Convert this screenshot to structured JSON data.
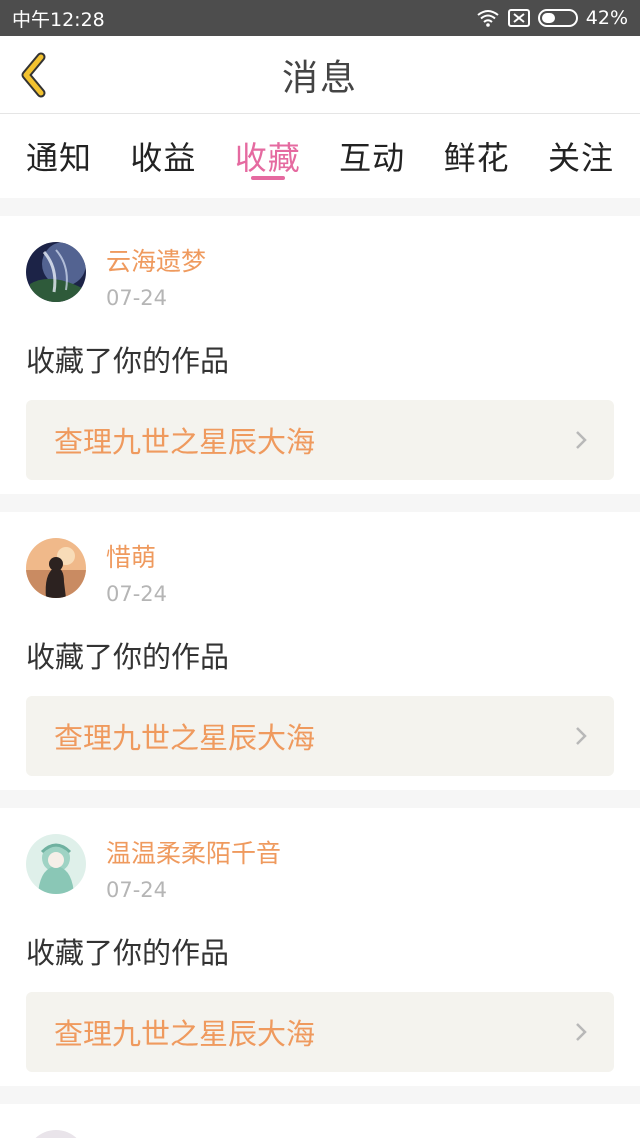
{
  "status_bar": {
    "time": "中午12:28",
    "battery_text": "42%",
    "battery_level": 0.42
  },
  "header": {
    "title": "消息"
  },
  "tabs": [
    {
      "label": "通知",
      "active": false
    },
    {
      "label": "收益",
      "active": false
    },
    {
      "label": "收藏",
      "active": true
    },
    {
      "label": "互动",
      "active": false
    },
    {
      "label": "鲜花",
      "active": false
    },
    {
      "label": "关注",
      "active": false
    }
  ],
  "messages": [
    {
      "username": "云海遗梦",
      "date": "07-24",
      "action": "收藏了你的作品",
      "work_title": "查理九世之星辰大海"
    },
    {
      "username": "惜萌",
      "date": "07-24",
      "action": "收藏了你的作品",
      "work_title": "查理九世之星辰大海"
    },
    {
      "username": "温温柔柔陌千音",
      "date": "07-24",
      "action": "收藏了你的作品",
      "work_title": "查理九世之星辰大海"
    }
  ],
  "colors": {
    "accent_pink": "#e56aa0",
    "accent_orange": "#ef9a5e",
    "back_icon": "#f2c230"
  }
}
